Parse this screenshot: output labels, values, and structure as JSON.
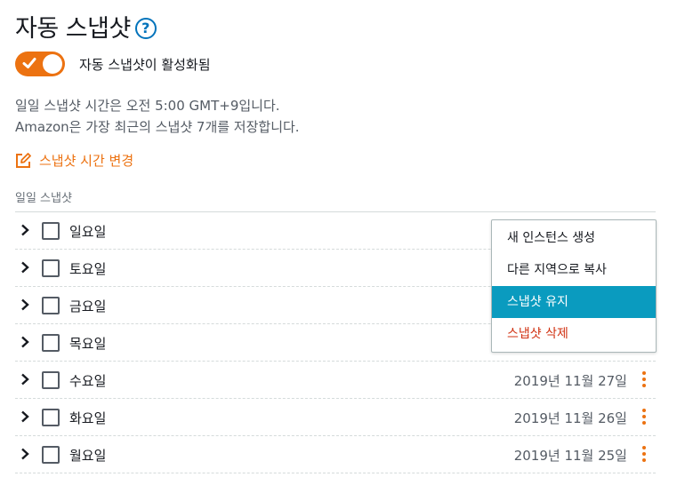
{
  "header": {
    "title": "자동 스냅샷",
    "help_icon": "question-circle-icon"
  },
  "toggle": {
    "on": true,
    "label": "자동 스냅샷이 활성화됨",
    "color": "#ec7211"
  },
  "description": {
    "line1": "일일 스냅샷 시간은 오전 5:00 GMT+9입니다.",
    "line2": "Amazon은 가장 최근의 스냅샷 7개를 저장합니다."
  },
  "change_time": {
    "label": "스냅샷 시간 변경",
    "icon": "edit-icon"
  },
  "section": {
    "label": "일일 스냅샷"
  },
  "rows": [
    {
      "day": "일요일",
      "date": ""
    },
    {
      "day": "토요일",
      "date": ""
    },
    {
      "day": "금요일",
      "date": ""
    },
    {
      "day": "목요일",
      "date": ""
    },
    {
      "day": "수요일",
      "date": "2019년 11월 27일"
    },
    {
      "day": "화요일",
      "date": "2019년 11월 26일"
    },
    {
      "day": "월요일",
      "date": "2019년 11월 25일"
    }
  ],
  "menu": {
    "items": [
      {
        "label": "새 인스턴스 생성"
      },
      {
        "label": "다른 지역으로 복사"
      },
      {
        "label": "스냅샷 유지"
      },
      {
        "label": "스냅샷 삭제"
      }
    ],
    "highlighted_index": 2
  },
  "colors": {
    "accent": "#ec7211",
    "highlight": "#0a9bbf",
    "danger": "#d13212",
    "link": "#0073bb"
  }
}
